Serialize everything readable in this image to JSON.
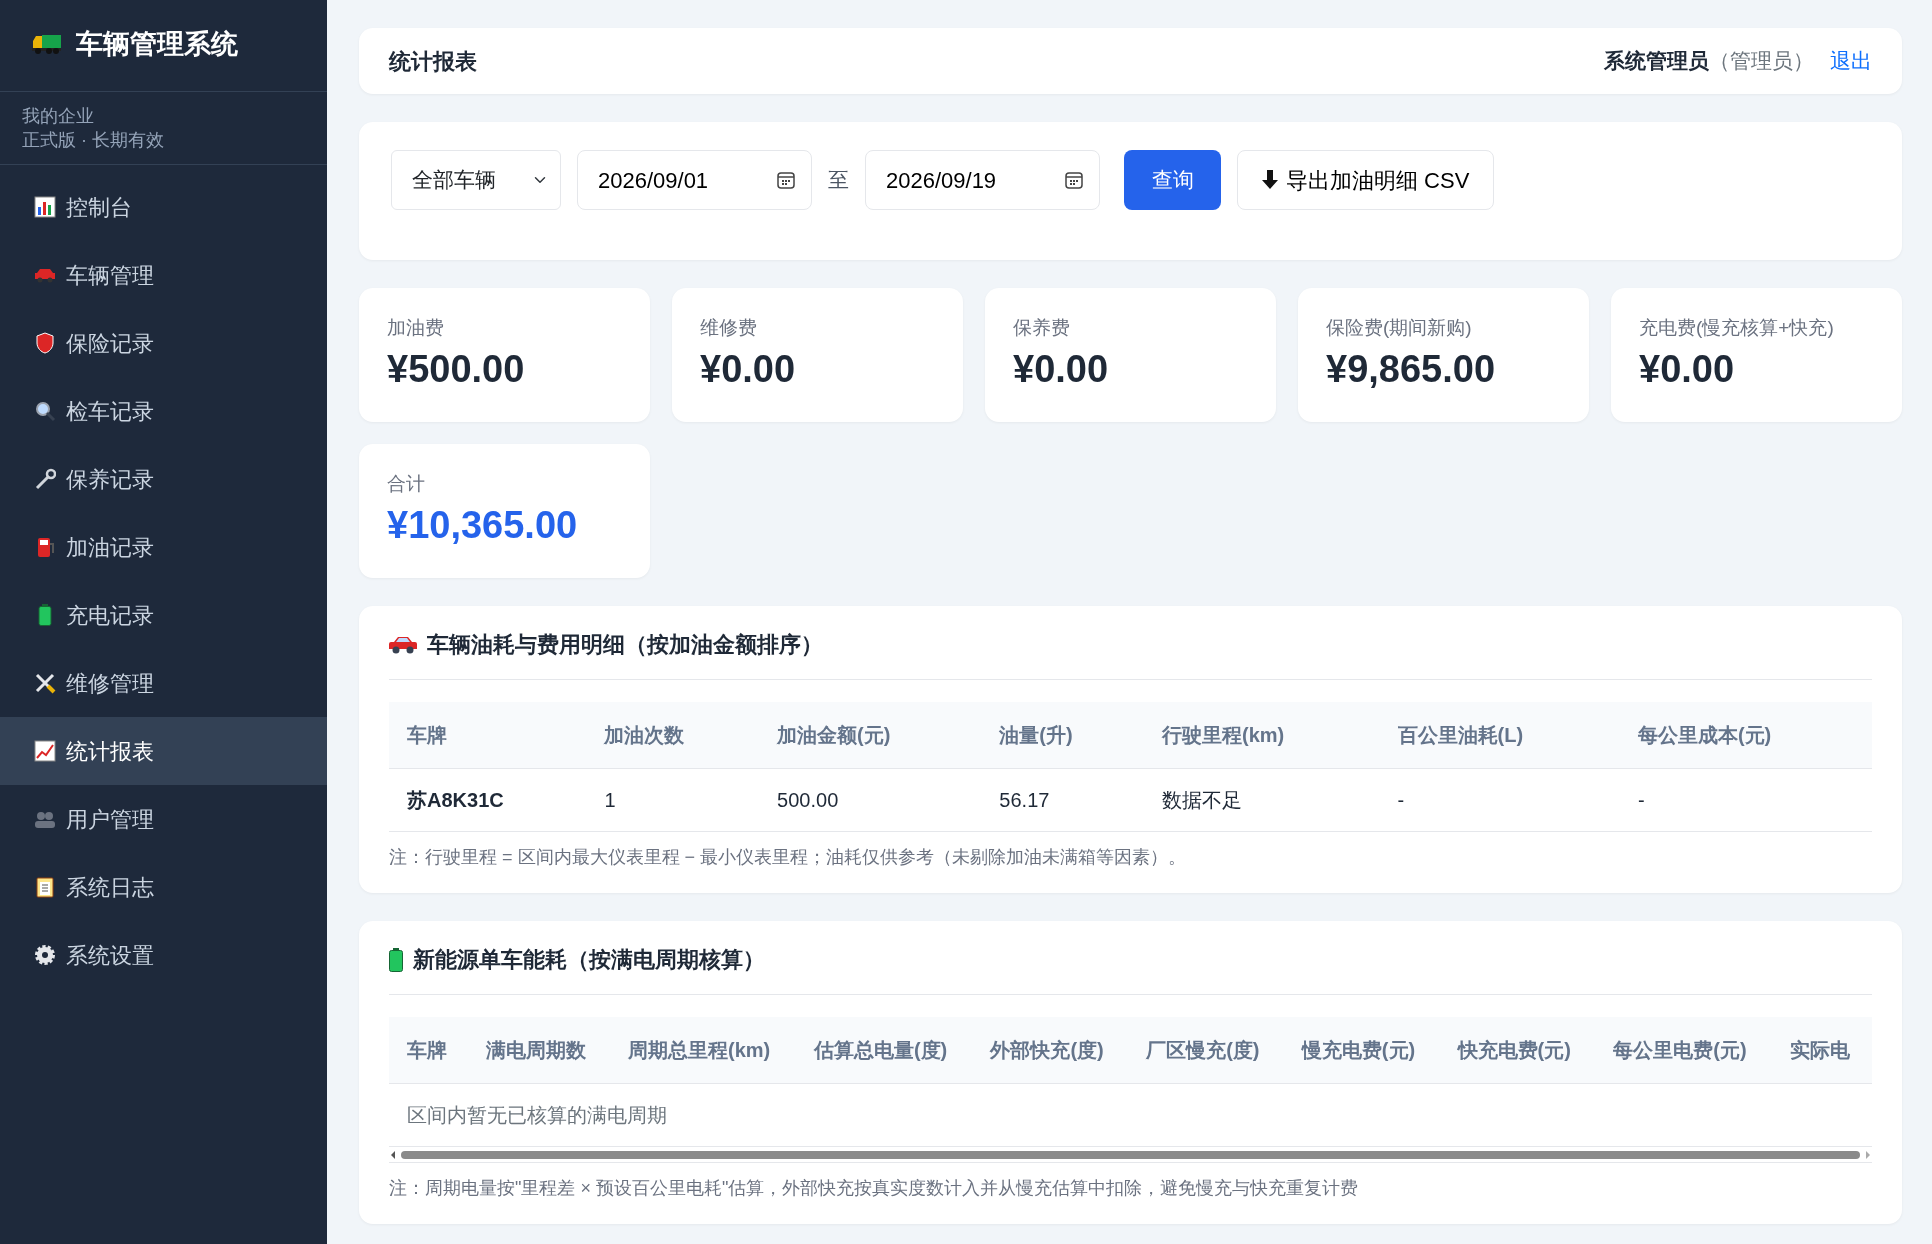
{
  "sidebar": {
    "brand": "车辆管理系统",
    "org": "我的企业",
    "plan": "正式版 · 长期有效",
    "items": [
      {
        "label": "控制台",
        "selected": false
      },
      {
        "label": "车辆管理",
        "selected": false
      },
      {
        "label": "保险记录",
        "selected": false
      },
      {
        "label": "检车记录",
        "selected": false
      },
      {
        "label": "保养记录",
        "selected": false
      },
      {
        "label": "加油记录",
        "selected": false
      },
      {
        "label": "充电记录",
        "selected": false
      },
      {
        "label": "维修管理",
        "selected": false
      },
      {
        "label": "统计报表",
        "selected": true
      },
      {
        "label": "用户管理",
        "selected": false
      },
      {
        "label": "系统日志",
        "selected": false
      },
      {
        "label": "系统设置",
        "selected": false
      }
    ]
  },
  "header": {
    "title": "统计报表",
    "user": "系统管理员",
    "role": "（管理员）",
    "logout": "退出"
  },
  "filters": {
    "vehicle": "全部车辆",
    "start": "2026/09/01",
    "separator": "至",
    "end": "2026/09/19",
    "query": "查询",
    "export": "导出加油明细 CSV"
  },
  "stats": [
    {
      "label": "加油费",
      "value": "¥500.00"
    },
    {
      "label": "维修费",
      "value": "¥0.00"
    },
    {
      "label": "保养费",
      "value": "¥0.00"
    },
    {
      "label": "保险费(期间新购)",
      "value": "¥9,865.00"
    },
    {
      "label": "充电费(慢充核算+快充)",
      "value": "¥0.00"
    }
  ],
  "total": {
    "label": "合计",
    "value": "¥10,365.00"
  },
  "fuel_table": {
    "title": "车辆油耗与费用明细（按加油金额排序）",
    "columns": [
      "车牌",
      "加油次数",
      "加油金额(元)",
      "油量(升)",
      "行驶里程(km)",
      "百公里油耗(L)",
      "每公里成本(元)"
    ],
    "rows": [
      [
        "苏A8K31C",
        "1",
        "500.00",
        "56.17",
        "数据不足",
        "-",
        "-"
      ]
    ],
    "note": "注：行驶里程 = 区间内最大仪表里程 − 最小仪表里程；油耗仅供参考（未剔除加油未满箱等因素）。"
  },
  "ev_table": {
    "title": "新能源单车能耗（按满电周期核算）",
    "columns": [
      "车牌",
      "满电周期数",
      "周期总里程(km)",
      "估算总电量(度)",
      "外部快充(度)",
      "厂区慢充(度)",
      "慢充电费(元)",
      "快充电费(元)",
      "每公里电费(元)",
      "实际电"
    ],
    "empty": "区间内暂无已核算的满电周期",
    "note": "注：周期电量按\"里程差 × 预设百公里电耗\"估算，外部快充按真实度数计入并从慢充估算中扣除，避免慢充与快充重复计费"
  }
}
